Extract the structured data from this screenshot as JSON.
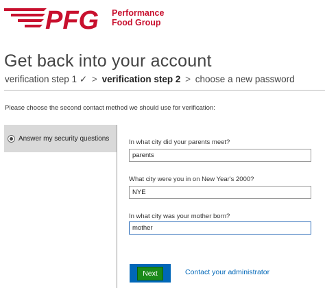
{
  "brand": {
    "logo_mark": "PFG",
    "name_line1": "Performance",
    "name_line2": "Food Group",
    "color": "#c8102e"
  },
  "page": {
    "title": "Get back into your account"
  },
  "steps": {
    "step1": "verification step 1",
    "step1_check": "✓",
    "separator": ">",
    "step2": "verification step 2",
    "step3": "choose a new password"
  },
  "instruction": "Please choose the second contact method we should use for verification:",
  "methods": [
    {
      "label": "Answer my security questions",
      "selected": true
    }
  ],
  "questions": [
    {
      "label": "In what city did your parents meet?",
      "value": "parents"
    },
    {
      "label": "What city were you in on New Year's 2000?",
      "value": "NYE"
    },
    {
      "label": "In what city was your mother born?",
      "value": "mother"
    }
  ],
  "actions": {
    "next_label": "Next",
    "contact_label": "Contact your administrator"
  },
  "colors": {
    "accent": "#0067b8",
    "next_highlight": "#1a8a1a",
    "selected_method_bg": "#d9d9d9"
  }
}
